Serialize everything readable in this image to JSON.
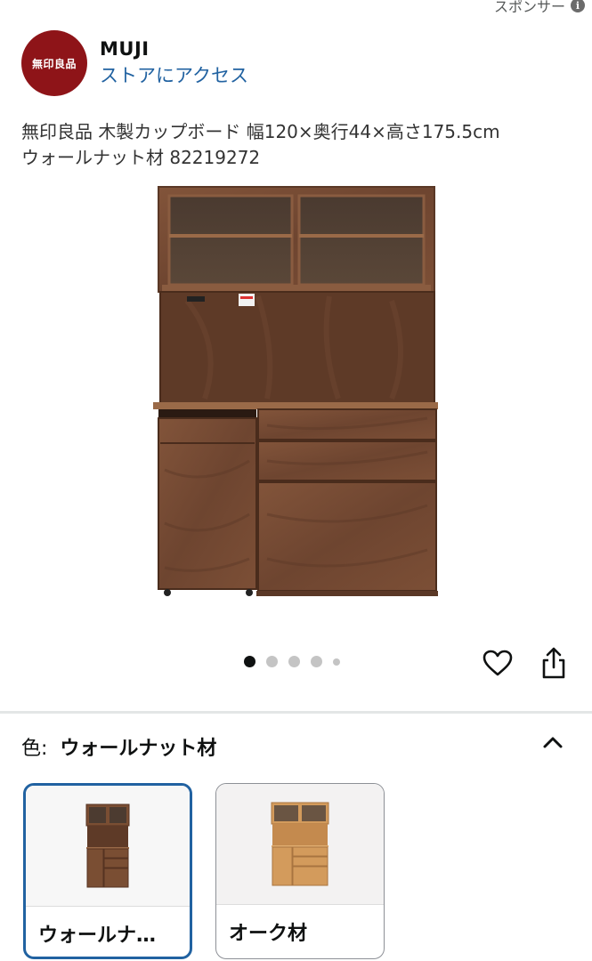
{
  "sponsored": {
    "label": "スポンサー",
    "icon": "info-icon"
  },
  "brand": {
    "logo_text": "無印良品",
    "name": "MUJI",
    "store_link": "ストアにアクセス",
    "logo_color": "#8e1418",
    "link_color": "#2162a1"
  },
  "product": {
    "title_line1": "無印良品 木製カップボード 幅120×奥行44×高さ175.5cm",
    "title_line2": "ウォールナット材 82219272",
    "image_count": 5,
    "active_image_index": 0
  },
  "actions": {
    "favorite_icon": "heart-icon",
    "share_icon": "share-icon"
  },
  "variation": {
    "label": "色:",
    "selected_value": "ウォールナット材",
    "expanded": true,
    "options": [
      {
        "label": "ウォールナ…",
        "selected": true,
        "wood_color": "#7a4e33"
      },
      {
        "label": "オーク材",
        "selected": false,
        "wood_color": "#d39b5c"
      }
    ]
  }
}
